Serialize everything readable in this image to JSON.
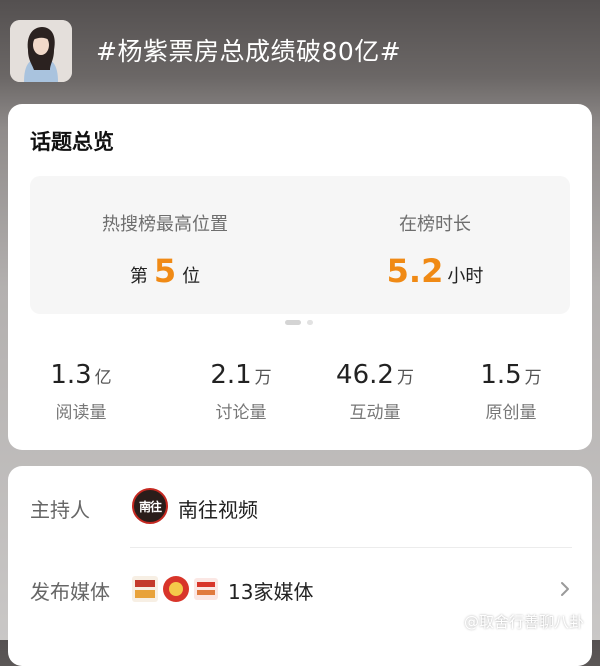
{
  "topic": {
    "title": "#杨紫票房总成绩破80亿#"
  },
  "overview": {
    "section_title": "话题总览",
    "highlights": [
      {
        "label": "热搜榜最高位置",
        "prefix": "第",
        "value": "5",
        "suffix": "位"
      },
      {
        "label": "在榜时长",
        "value": "5.2",
        "suffix": "小时"
      }
    ],
    "stats": [
      {
        "value": "1.3",
        "unit": "亿",
        "label": "阅读量"
      },
      {
        "value": "2.1",
        "unit": "万",
        "label": "讨论量"
      },
      {
        "value": "46.2",
        "unit": "万",
        "label": "互动量"
      },
      {
        "value": "1.5",
        "unit": "万",
        "label": "原创量"
      }
    ]
  },
  "info": {
    "host_label": "主持人",
    "host_name": "南往视频",
    "host_logo_text": "南往",
    "media_label": "发布媒体",
    "media_count": "13家媒体"
  },
  "watermark": "@取舍行善聊八卦",
  "colors": {
    "accent": "#f08a15",
    "host_logo_ring": "#c42820"
  },
  "icons": {
    "chevron": "chevron-right-icon",
    "watermark": "weibo-icon"
  }
}
